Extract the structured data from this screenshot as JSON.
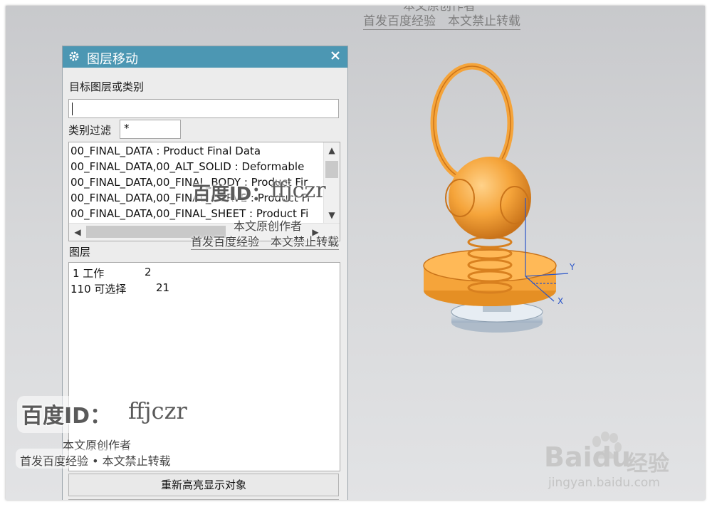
{
  "watermark": {
    "top_line1": "本文原创作者",
    "top_line2": "首发百度经验　本文禁止转载",
    "mid_id": "百度ID：",
    "mid_name": "ffjczr",
    "mid_line1": "本文原创作者",
    "mid_line2": "首发百度经验　本文禁止转载",
    "left_id": "百度ID：",
    "left_name": "ffjczr",
    "left_line1": "本文原创作者",
    "left_line2": "首发百度经验 • 本文禁止转载",
    "baidu_brand": "Baidu",
    "baidu_cn": "经验",
    "baidu_url": "jingyan.baidu.com"
  },
  "dialog": {
    "title": "图层移动",
    "target_label": "目标图层或类别",
    "target_value": "",
    "filter_label": "类别过滤",
    "filter_value": "*",
    "categories": [
      "00_FINAL_DATA : Product Final Data",
      "00_FINAL_DATA,00_ALT_SOLID : Deformable",
      "00_FINAL_DATA,00_FINAL_BODY : Product Fir",
      "00_FINAL_DATA,00_FINAL_CURVE : Product Fi",
      "00_FINAL_DATA,00_FINAL_SHEET : Product Fi"
    ],
    "layers_label": "图层",
    "layers": [
      {
        "name": " 1 工作",
        "count": "2"
      },
      {
        "name": "110 可选择",
        "count": "21"
      }
    ],
    "rehighlight_button": "重新高亮显示对象"
  },
  "viewport": {
    "axis_x": "X",
    "axis_y": "Y"
  },
  "colors": {
    "titlebar": "#4c97b3",
    "model_orange": "#f5a43a",
    "axis_blue": "#2a55c9"
  },
  "icons": {
    "gear": "gear-icon",
    "close": "close-icon",
    "scroll_up": "chevron-up-icon",
    "scroll_down": "chevron-down-icon",
    "scroll_left": "chevron-left-icon",
    "scroll_right": "chevron-right-icon"
  }
}
